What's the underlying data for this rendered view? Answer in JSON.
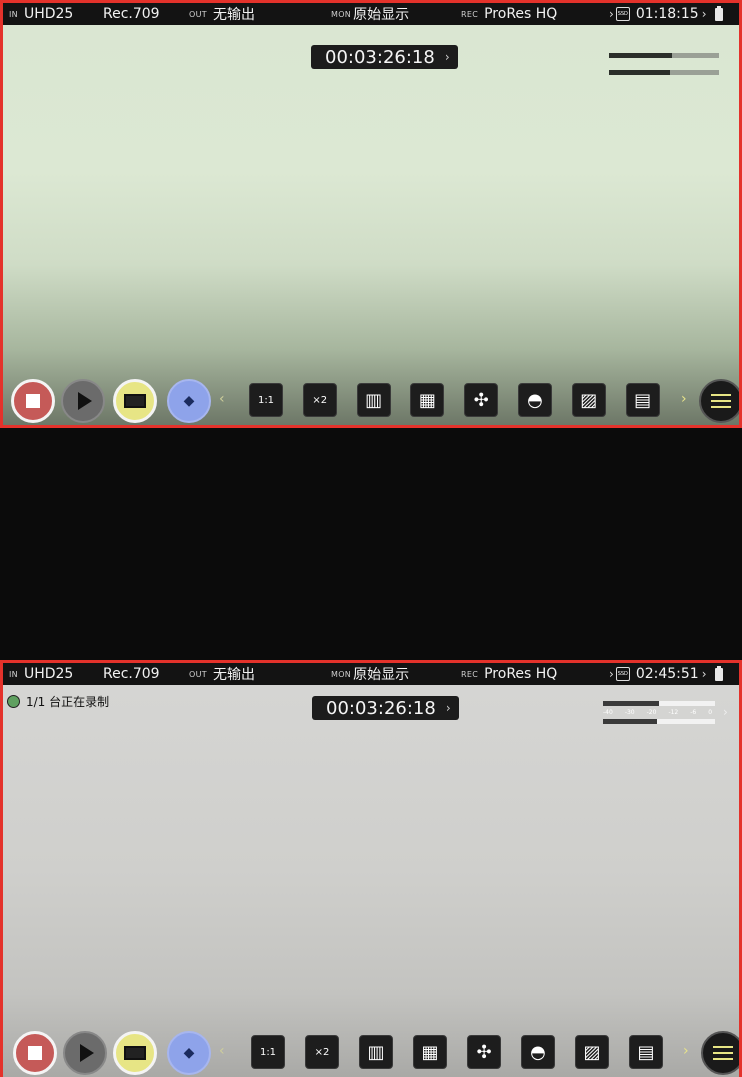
{
  "top": {
    "status": {
      "in_tag": "IN",
      "in_value": "UHD25",
      "gamma": "Rec.709",
      "out_tag": "OUT",
      "out_value": "无输出",
      "mon_tag": "MON",
      "mon_value": "原始显示",
      "rec_tag": "REC",
      "rec_value": "ProRes HQ",
      "ssd_label": "SSD",
      "time_remaining": "01:18:15"
    },
    "timecode": "00:03:26:18",
    "meter_levels": [
      0.57,
      0.55
    ]
  },
  "bottom": {
    "status": {
      "in_tag": "IN",
      "in_value": "UHD25",
      "gamma": "Rec.709",
      "out_tag": "OUT",
      "out_value": "无输出",
      "mon_tag": "MON",
      "mon_value": "原始显示",
      "rec_tag": "REC",
      "rec_value": "ProRes HQ",
      "ssd_label": "SSD",
      "time_remaining": "02:45:51"
    },
    "timecode": "00:03:26:18",
    "recording_badge": "1/1 台正在录制",
    "meter_scale": [
      "-40",
      "-30",
      "-20",
      "-12",
      "-6",
      "0"
    ],
    "meter_levels": [
      0.5,
      0.48
    ]
  },
  "toolbar": {
    "tools": [
      {
        "icon": "zoom-1to1-icon",
        "label": "1:1"
      },
      {
        "icon": "zoom-x2-icon",
        "label": "×2"
      },
      {
        "icon": "waveform-icon",
        "label": ""
      },
      {
        "icon": "rgb-parade-icon",
        "label": ""
      },
      {
        "icon": "vectorscope-icon",
        "label": ""
      },
      {
        "icon": "false-color-icon",
        "label": ""
      },
      {
        "icon": "zebra-icon",
        "label": ""
      },
      {
        "icon": "lut-icon",
        "label": ""
      }
    ]
  },
  "colors": {
    "frame_red": "#e4322b",
    "record_red": "#c55a58",
    "monitor_yellow": "#e7e585",
    "tag_blue": "#8ea3ea"
  }
}
